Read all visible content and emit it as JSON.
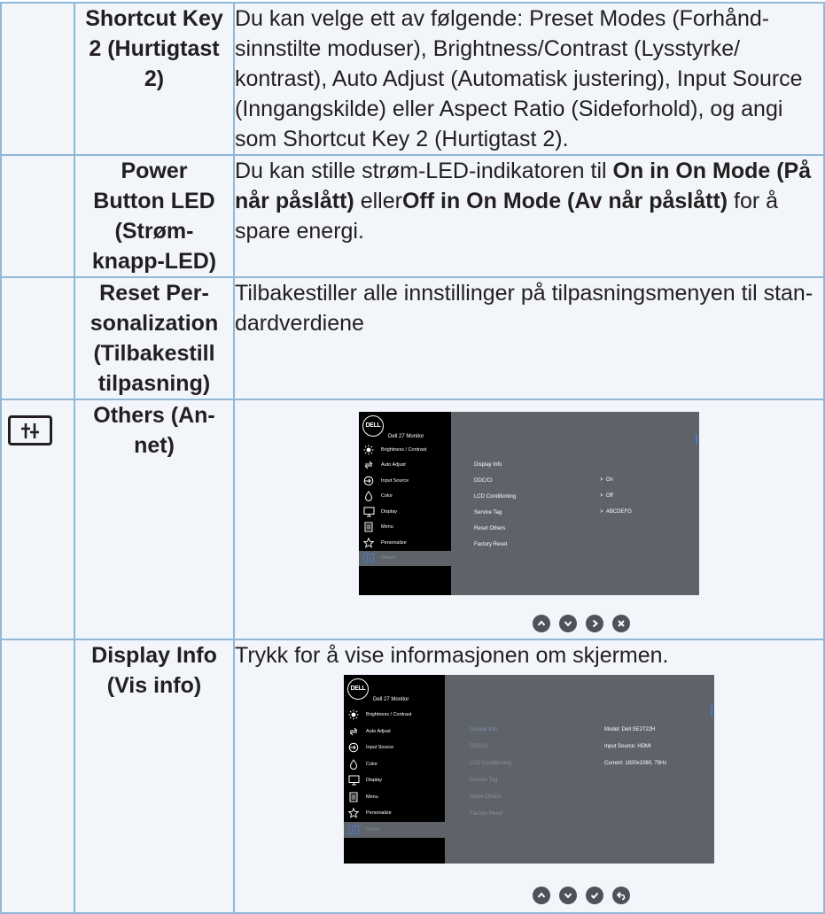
{
  "rows": [
    {
      "name": "Shortcut Key 2 (Hurtigtast 2)",
      "name_lines": [
        "Shortcut Key",
        "2 (Hurtigtast",
        "2)"
      ],
      "desc_lines": [
        "Du kan velge ett av følgende: Preset Modes (Forhånd-",
        "sinnstilte moduser), Brightness/Contrast (Lysstyrke/",
        "kontrast), Auto Adjust (Automatisk justering), Input Source",
        "(Inngangskilde) eller Aspect Ratio (Sideforhold), og angi",
        "som Shortcut Key 2 (Hurtigtast 2)."
      ]
    },
    {
      "name_lines": [
        "Power",
        "Button LED",
        "(Strøm-",
        "knapp-LED)"
      ],
      "desc_line1_a": "Du kan stille strøm-LED-indikatoren til ",
      "desc_line1_b": "On in On Mode (På",
      "desc_line2_a": "når påslått)",
      "desc_line2_b": " eller",
      "desc_line2_c": "Off in On Mode (Av når påslått)",
      "desc_line2_d": " for å",
      "desc_line3": "spare energi."
    },
    {
      "name_lines": [
        "Reset Per-",
        "sonalization",
        "(Tilbakestill",
        "tilpasning)"
      ],
      "desc_lines": [
        "Tilbakestiller alle innstillinger på tilpasningsmenyen til stan-",
        "dardverdiene"
      ]
    },
    {
      "icon": "others-sliders-icon",
      "name_lines": [
        "Others (An-",
        "net)"
      ]
    },
    {
      "name_lines": [
        "Display Info",
        "(Vis info)"
      ],
      "desc": "Trykk for å vise informasjonen om skjermen."
    }
  ],
  "osd": {
    "title": "Dell 27 Monitor",
    "logo": "DELL",
    "menu": [
      "Brightness / Contrast",
      "Auto Adjust",
      "Input Source",
      "Color",
      "Display",
      "Menu",
      "Personalize",
      "Others"
    ],
    "others_submenu": [
      "Display Info",
      "DDC/CI",
      "LCD Conditioning",
      "Service Tag",
      "Reset Others",
      "Factory Reset"
    ],
    "others_values": [
      "On",
      "Off",
      "ABCDEFG"
    ],
    "info_values": [
      "Model: Dell SE2722H",
      "Input Source: HDMI",
      "Current: 1920x1080, 75Hz"
    ]
  },
  "nav_icons_1": [
    "up-arrow-icon",
    "down-arrow-icon",
    "right-arrow-icon",
    "close-icon"
  ],
  "nav_icons_2": [
    "up-arrow-icon",
    "down-arrow-icon",
    "check-icon",
    "back-icon"
  ]
}
